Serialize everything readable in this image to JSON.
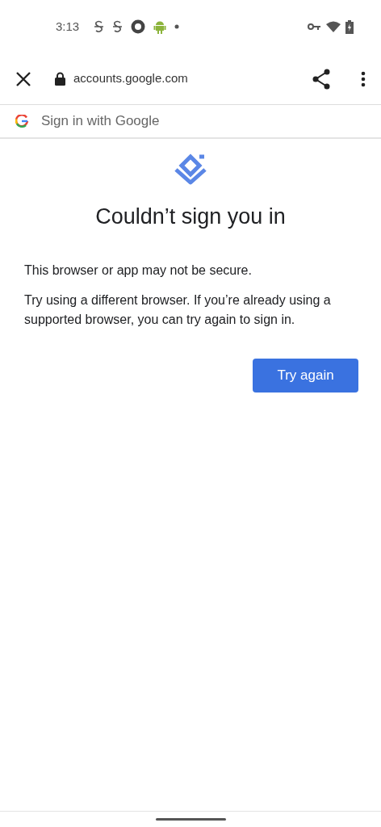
{
  "status_bar": {
    "time": "3:13"
  },
  "browser_bar": {
    "url": "accounts.google.com"
  },
  "tab_header": {
    "title": "Sign in with Google"
  },
  "page": {
    "heading": "Couldn’t sign you in",
    "paragraphs": [
      "This browser or app may not be secure.",
      "Try using a different browser. If you’re already using a supported browser, you can try again to sign in."
    ],
    "button": "Try again"
  }
}
